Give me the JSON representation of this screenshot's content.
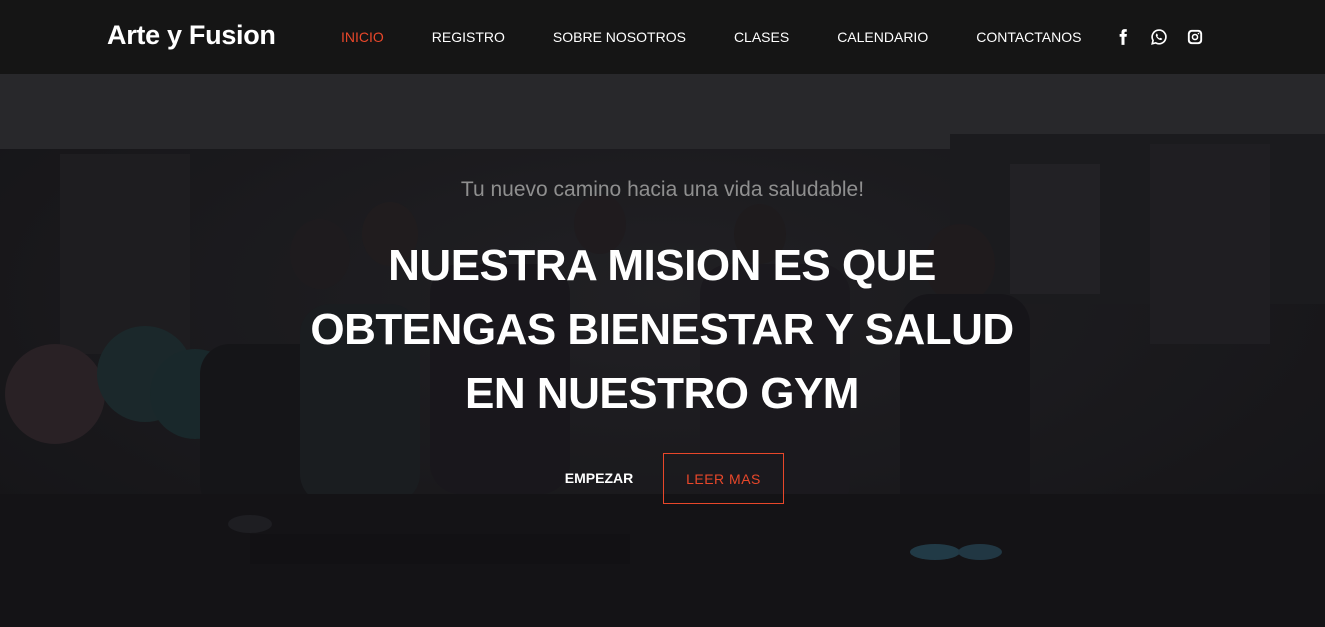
{
  "brand": {
    "name": "Arte y Fusion"
  },
  "nav": {
    "items": [
      {
        "label": "INICIO",
        "active": true
      },
      {
        "label": "REGISTRO",
        "active": false
      },
      {
        "label": "SOBRE NOSOTROS",
        "active": false
      },
      {
        "label": "CLASES",
        "active": false
      },
      {
        "label": "CALENDARIO",
        "active": false
      },
      {
        "label": "CONTACTANOS",
        "active": false
      }
    ]
  },
  "social": {
    "icons": [
      "facebook-icon",
      "whatsapp-icon",
      "instagram-icon"
    ]
  },
  "hero": {
    "tagline": "Tu nuevo camino hacia una vida saludable!",
    "headline_lines": [
      "NUESTRA MISION ES QUE",
      "OBTENGAS BIENESTAR Y SALUD",
      "EN NUESTRO GYM"
    ],
    "primary_button": "EMPEZAR",
    "secondary_button": "LEER MAS"
  },
  "colors": {
    "accent": "#e8472a",
    "navbar": "#151515",
    "text": "#ffffff",
    "tagline": "#8f8f8f"
  }
}
